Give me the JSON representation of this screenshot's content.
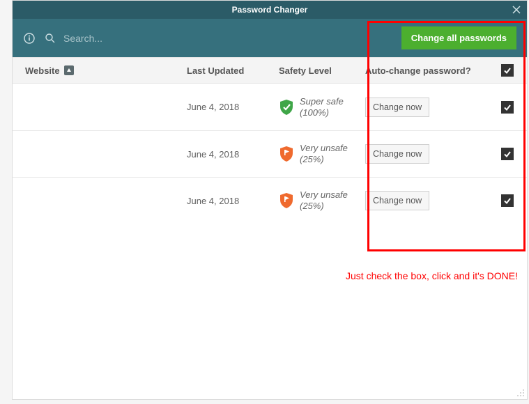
{
  "window": {
    "title": "Password Changer"
  },
  "toolbar": {
    "search_placeholder": "Search...",
    "change_all_label": "Change all passwords"
  },
  "columns": {
    "website": "Website",
    "last_updated": "Last Updated",
    "safety_level": "Safety Level",
    "auto_change": "Auto-change password?"
  },
  "header_checkbox": true,
  "rows": [
    {
      "last_updated": "June 4, 2018",
      "safety_label": "Super safe",
      "safety_percent": "(100%)",
      "safety_kind": "safe",
      "action_label": "Change now",
      "checked": true
    },
    {
      "last_updated": "June 4, 2018",
      "safety_label": "Very unsafe",
      "safety_percent": "(25%)",
      "safety_kind": "unsafe",
      "action_label": "Change now",
      "checked": true
    },
    {
      "last_updated": "June 4, 2018",
      "safety_label": "Very unsafe",
      "safety_percent": "(25%)",
      "safety_kind": "unsafe",
      "action_label": "Change now",
      "checked": true
    }
  ],
  "annotation": "Just check the box, click and it's DONE!"
}
